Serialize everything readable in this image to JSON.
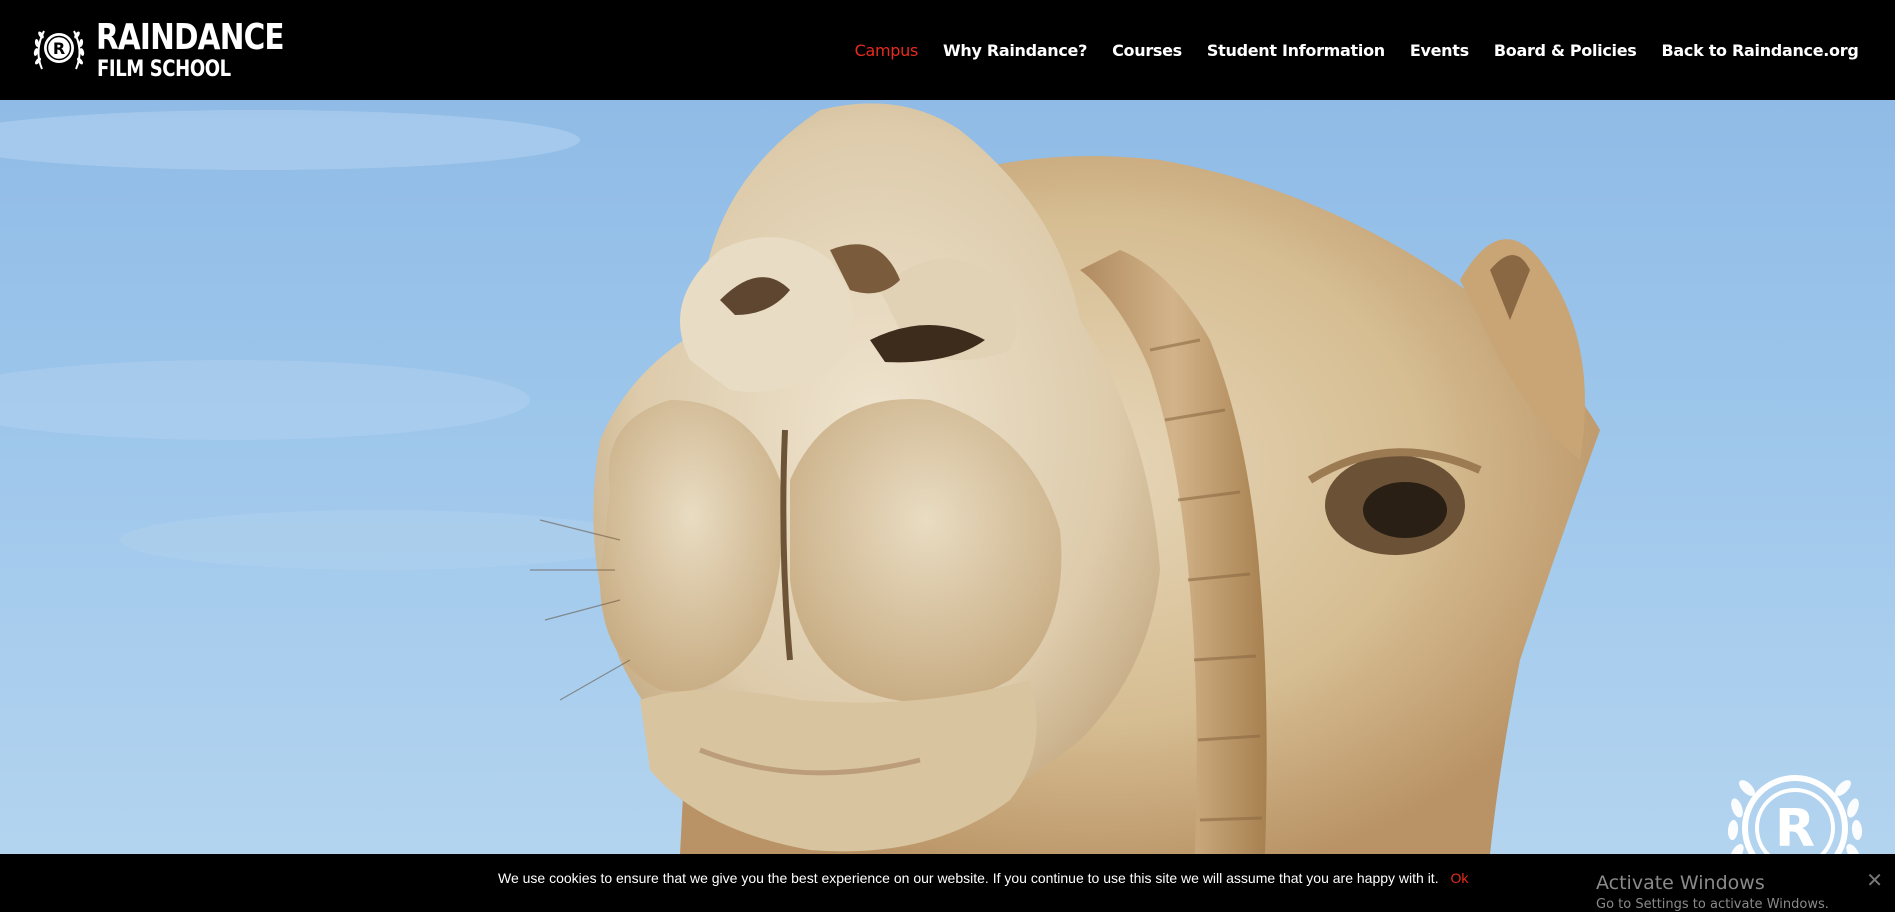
{
  "header": {
    "logo": {
      "line1": "RAINDANCE",
      "line2": "FILM SCHOOL",
      "emblem_letter": "R"
    },
    "nav": [
      {
        "label": "Campus",
        "active": true
      },
      {
        "label": "Why Raindance?",
        "active": false
      },
      {
        "label": "Courses",
        "active": false
      },
      {
        "label": "Student Information",
        "active": false
      },
      {
        "label": "Events",
        "active": false
      },
      {
        "label": "Board & Policies",
        "active": false
      },
      {
        "label": "Back to Raindance.org",
        "active": false
      }
    ]
  },
  "hero": {
    "image_subject": "camel-closeup-photo",
    "corner_emblem_letter": "R"
  },
  "cookie_bar": {
    "message": "We use cookies to ensure that we give you the best experience on our website. If you continue to use this site we will assume that you are happy with it.",
    "ok_label": "Ok",
    "close_icon": "close-icon"
  },
  "windows_watermark": {
    "title": "Activate Windows",
    "subtitle": "Go to Settings to activate Windows."
  },
  "colors": {
    "header_bg": "#000000",
    "accent": "#e62b1e",
    "sky": "#9cc5ea"
  }
}
